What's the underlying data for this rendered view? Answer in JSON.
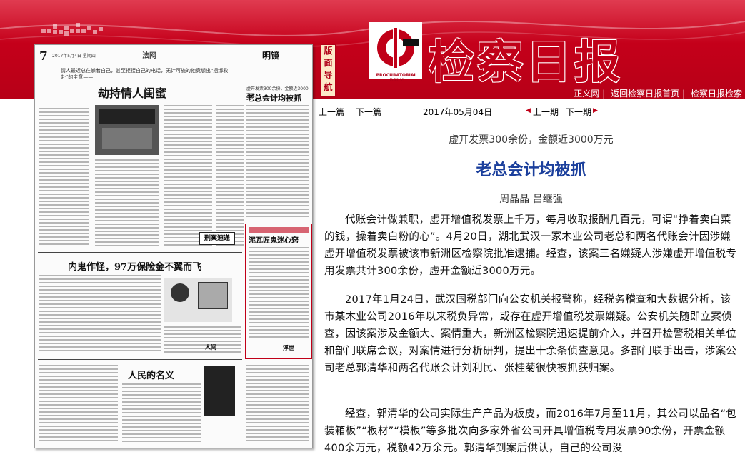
{
  "header": {
    "logo_caption": "PROCURATORIAL DAILY",
    "masthead": "检察日报",
    "nav_badge": "版面导航",
    "links": [
      "正义网",
      "返回检察日报首页",
      "检察日报检索"
    ],
    "colors": {
      "header_red": "#c8001c",
      "title_blue": "#1b3f9c"
    }
  },
  "newspaper_page": {
    "page_no": "7",
    "date_line": "2017年5月4日  星期四",
    "section": "法网",
    "column": "明镜",
    "lead_note": "情人最近总在躲着自己，甚至拒接自己的电话，无计可施的他竟想出\"捆绑救赴\"的主意——",
    "headline1": "劫持情人闺蜜",
    "headline2": "老总会计均被抓",
    "headline2_kicker": "虚开发票300余份，金额近3000万元",
    "headline3": "内鬼作怪，97万保险金不翼而飞",
    "headline4": "人民的名义",
    "headline5": "泥瓦匠鬼迷心窍",
    "tag1": "刑案速递",
    "tag2": "人间",
    "tag3": "浮世"
  },
  "toolbar": {
    "prev_article": "上一篇",
    "next_article": "下一篇",
    "date": "2017年05月04日",
    "prev_issue": "上一期",
    "next_issue": "下一期"
  },
  "article": {
    "subtitle": "虚开发票300余份，金额近3000万元",
    "title": "老总会计均被抓",
    "authors": "周晶晶  吕继强",
    "paragraphs": [
      "代账会计做兼职，虚开增值税发票上千万，每月收取报酬几百元，可谓“挣着卖白菜的钱，操着卖白粉的心”。4月20日，湖北武汉一家木业公司老总和两名代账会计因涉嫌虚开增值税发票被该市新洲区检察院批准逮捕。经查，该案三名嫌疑人涉嫌虚开增值税专用发票共计300余份，虚开金额近3000万元。",
      "2017年1月24日，武汉国税部门向公安机关报警称，经税务稽查和大数据分析，该市某木业公司2016年以来税负异常，或存在虚开增值税发票嫌疑。公安机关随即立案侦查，因该案涉及金额大、案情重大，新洲区检察院迅速提前介入，并召开检警税相关单位和部门联席会议，对案情进行分析研判，提出十余条侦查意见。多部门联手出击，涉案公司老总郭清华和两名代账会计刘利民、张桂菊很快被抓获归案。",
      "经查，郭清华的公司实际生产产品为板皮，而2016年7月至11月，其公司以品名“包装箱板”“板材”“模板”等多批次向多家外省公司开具增值税专用发票90余份，开票金额400余万元，税额42万余元。郭清华到案后供认，自己的公司没"
    ]
  }
}
